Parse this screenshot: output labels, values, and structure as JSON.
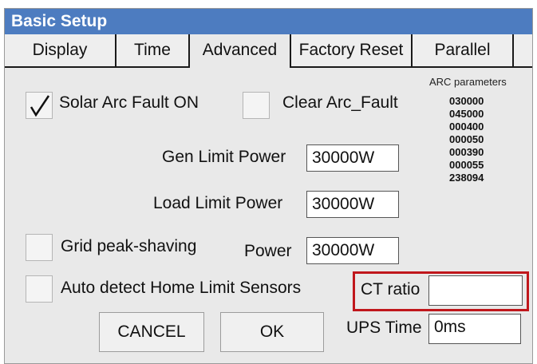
{
  "window": {
    "title": "Basic Setup"
  },
  "tabs": [
    {
      "label": "Display"
    },
    {
      "label": "Time"
    },
    {
      "label": "Advanced"
    },
    {
      "label": "Factory Reset"
    },
    {
      "label": "Parallel"
    }
  ],
  "solar_arc": {
    "label": "Solar Arc Fault ON",
    "checked": true
  },
  "clear_arc": {
    "label": "Clear Arc_Fault",
    "checked": false
  },
  "arc_parameters": {
    "title": "ARC parameters",
    "values": [
      "030000",
      "045000",
      "000400",
      "000050",
      "000390",
      "000055",
      "238094"
    ]
  },
  "gen_limit": {
    "label": "Gen Limit Power",
    "value": "30000W"
  },
  "load_limit": {
    "label": "Load Limit Power",
    "value": "30000W"
  },
  "grid_peak": {
    "label": "Grid peak-shaving",
    "checked": false,
    "power_label": "Power",
    "power_value": "30000W"
  },
  "auto_detect": {
    "label": "Auto detect Home Limit Sensors",
    "checked": false
  },
  "ct_ratio": {
    "label": "CT ratio",
    "value": ""
  },
  "ups_time": {
    "label": "UPS Time",
    "value": "0ms"
  },
  "buttons": {
    "cancel": "CANCEL",
    "ok": "OK"
  },
  "colors": {
    "title_bar": "#4d7cc0",
    "highlight": "#c0171c"
  }
}
